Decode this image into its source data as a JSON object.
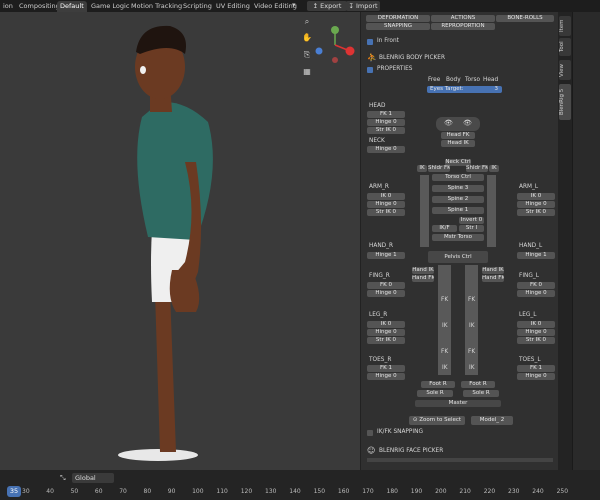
{
  "topbar": {
    "tabs": [
      "ion",
      "Compositing",
      "Default",
      "Game Logic",
      "Motion Tracking",
      "Scripting",
      "UV Editing",
      "Video Editing"
    ],
    "active_tab": "Default",
    "export_label": "Export",
    "import_label": "Import"
  },
  "panel": {
    "top_buttons": [
      "DEFORMATION",
      "ACTIONS",
      "BONE-ROLLS",
      "SNAPPING",
      "REPROPORTION"
    ],
    "in_front": "In Front",
    "body_picker_title": "BLENRIG BODY PICKER",
    "properties": "PROPERTIES",
    "eye_header": [
      "Free",
      "Body",
      "Torso",
      "Head"
    ],
    "eyes_target_label": "Eyes Target:",
    "eyes_target_value": "3",
    "head_label": "HEAD",
    "head_buttons": [
      "FK 1",
      "Hinge 0",
      "Str IK 0"
    ],
    "neck_label": "NECK",
    "neck_hinge": "Hinge 0",
    "head_fk": "Head FK",
    "head_ik": "Head IK",
    "neck_ctrl": "Neck Ctrl",
    "ik_l": "IK",
    "shldr_fk_l": "Shldr FK",
    "shldr_fk_r": "Shldr FK",
    "ik_r": "IK",
    "torso_ctrl": "Torso Ctrl",
    "spine3": "Spine 3",
    "spine2": "Spine 2",
    "spine1": "Spine 1",
    "invert": "Invert 0",
    "ikf": "IK/F",
    "str_i": "Str I",
    "mstr_torso": "Mstr Torso",
    "pelvis_ctrl": "Pelvis Ctrl",
    "arm_r_label": "ARM_R",
    "arm_r_buttons": [
      "IK 0",
      "Hinge 0",
      "Str IK 0"
    ],
    "arm_l_label": "ARM_L",
    "arm_l_buttons": [
      "IK 0",
      "Hinge 0",
      "Str IK 0"
    ],
    "hand_r_label": "HAND_R",
    "hand_r_hinge": "Hinge 1",
    "hand_l_label": "HAND_L",
    "hand_l_hinge": "Hinge 1",
    "hand_ik": "Hand IK",
    "hand_fk": "Hand FK",
    "fing_r_label": "FING_R",
    "fing_r_buttons": [
      "FK 0",
      "Hinge 0"
    ],
    "fing_l_label": "FING_L",
    "fing_l_buttons": [
      "FK 0",
      "Hinge 0"
    ],
    "leg_r_label": "LEG_R",
    "leg_r_buttons": [
      "IK 0",
      "Hinge 0",
      "Str IK 0"
    ],
    "leg_l_label": "LEG_L",
    "leg_l_buttons": [
      "IK 0",
      "Hinge 0",
      "Str IK 0"
    ],
    "toes_r_label": "TOES_R",
    "toes_r_buttons": [
      "FK 1",
      "Hinge 0"
    ],
    "toes_l_label": "TOES_L",
    "toes_l_buttons": [
      "FK 1",
      "Hinge 0"
    ],
    "ik_letter": "IK",
    "fk_letter": "FK",
    "foot_r": "Foot R",
    "foot_ri": "Foot R",
    "sole_r": "Sole R",
    "sole_r2": "Sole R",
    "master": "Master",
    "zoom_label": "Zoom to Select",
    "model_label": "Model_",
    "model_value": "2",
    "ikfk_snapping": "IK/FK SNAPPING",
    "face_picker_title": "BLENRIG FACE PICKER"
  },
  "sidebar_tabs": [
    "Item",
    "Tool",
    "View",
    "BlenRig 5"
  ],
  "timeline": {
    "current_frame": "35",
    "transform_orientation": "Global",
    "ticks": [
      "30",
      "40",
      "50",
      "60",
      "70",
      "80",
      "90",
      "100",
      "110",
      "120",
      "130",
      "140",
      "150",
      "160",
      "170",
      "180",
      "190",
      "200",
      "210",
      "220",
      "230",
      "240",
      "250"
    ]
  },
  "colors": {
    "accent": "#4772b3",
    "viewport": "#3a3a3a",
    "panel": "#303030",
    "skin": "#6b3a22",
    "shirt": "#2e6b63",
    "current_frame": "#4772b3"
  }
}
